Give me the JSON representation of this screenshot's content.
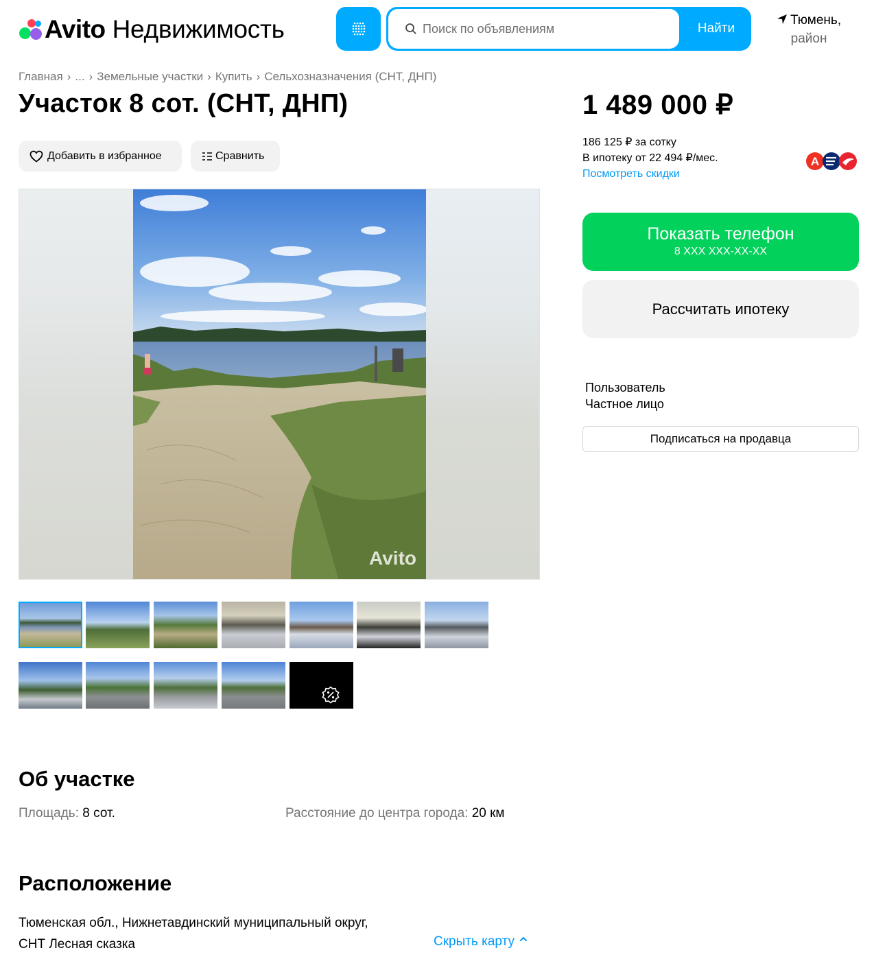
{
  "header": {
    "logo_brand": "Avito",
    "logo_section": "Недвижимость",
    "search_placeholder": "Поиск по объявлениям",
    "search_button": "Найти",
    "region_line1": "Тюмень,",
    "region_line2": "район",
    "accent_color": "#00aaff"
  },
  "breadcrumbs": [
    "Главная",
    "...",
    "Земельные участки",
    "Купить",
    "Сельхозназначения (СНТ, ДНП)"
  ],
  "listing": {
    "title": "Участок 8 сот. (СНТ, ДНП)",
    "add_favorite": "Добавить в избранное",
    "compare": "Сравнить",
    "watermark": "Avito"
  },
  "gallery": {
    "thumbnail_count": 13,
    "active_index": 0
  },
  "price": {
    "value": "1 489 000 ₽",
    "per_sotka": "186 125 ₽ за сотку",
    "mortgage": "В ипотеку от 22 494 ₽/мес.",
    "discounts_link": "Посмотреть скидки"
  },
  "actions": {
    "show_phone": "Показать телефон",
    "phone_masked": "8 XXX XXX-XX-XX",
    "calc_mortgage": "Рассчитать ипотеку",
    "phone_color": "#02d15c"
  },
  "seller": {
    "name": "Пользователь",
    "type": "Частное лицо",
    "subscribe": "Подписаться на продавца"
  },
  "about": {
    "heading": "Об участке",
    "area_label": "Площадь:",
    "area_value": "8 сот.",
    "distance_label": "Расстояние до центра города:",
    "distance_value": "20 км"
  },
  "location": {
    "heading": "Расположение",
    "address_line1": "Тюменская обл., Нижнетавдинский муниципальный округ,",
    "address_line2": "СНТ Лесная сказка",
    "hide_map": "Скрыть карту"
  }
}
